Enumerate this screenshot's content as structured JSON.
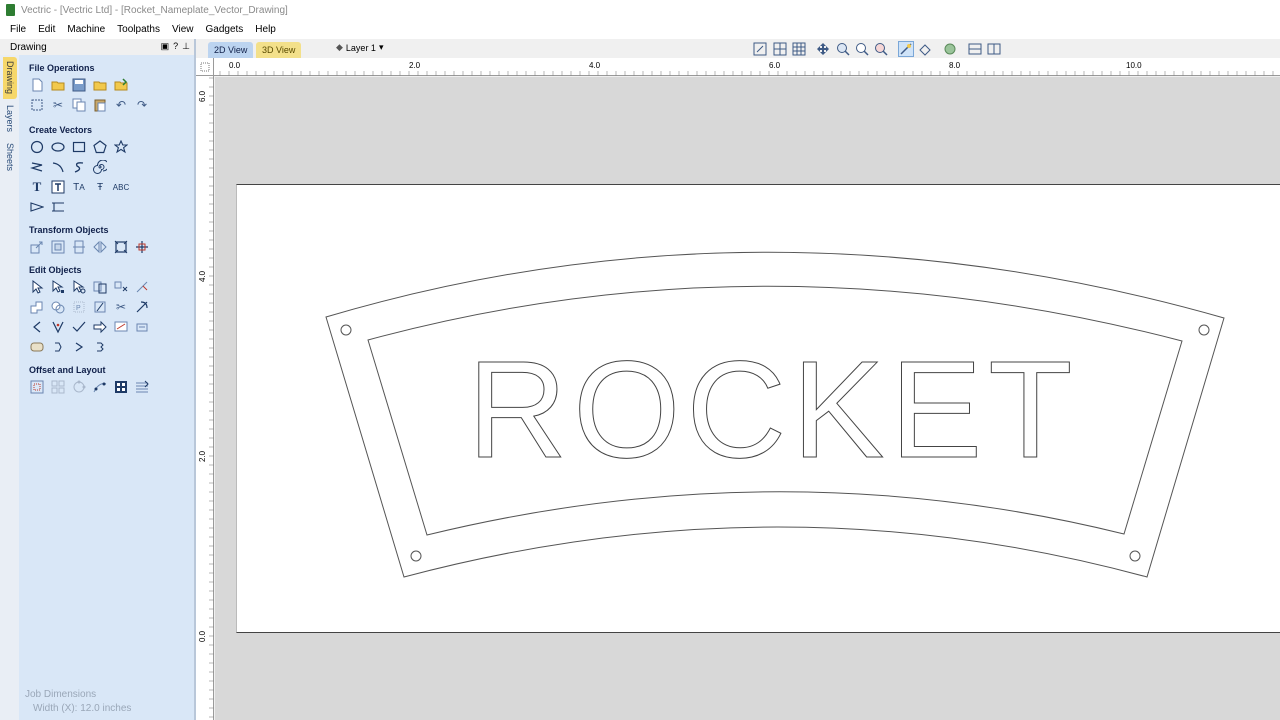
{
  "window": {
    "title": "Vectric - [Vectric Ltd] - [Rocket_Nameplate_Vector_Drawing]"
  },
  "menu": [
    "File",
    "Edit",
    "Machine",
    "Toolpaths",
    "View",
    "Gadgets",
    "Help"
  ],
  "panel": {
    "title": "Drawing",
    "vertical_tabs": [
      "Drawing",
      "Layers",
      "Sheets"
    ],
    "sections": {
      "file_operations": "File Operations",
      "create_vectors": "Create Vectors",
      "transform_objects": "Transform Objects",
      "edit_objects": "Edit Objects",
      "offset_layout": "Offset and Layout"
    },
    "job_dimensions": {
      "title": "Job Dimensions",
      "width": "Width  (X): 12.0 inches"
    }
  },
  "view": {
    "tab_2d": "2D View",
    "tab_3d": "3D View",
    "layer": "Layer 1"
  },
  "rulers": {
    "top_labels": [
      "0.0",
      "2.0",
      "4.0",
      "6.0",
      "8.0",
      "10.0"
    ],
    "left_labels": [
      "6.0",
      "4.0",
      "2.0",
      "0.0"
    ]
  },
  "drawing": {
    "text": "ROCKET"
  },
  "colors": {
    "panel": "#d9e7f7",
    "active_tab": "#f6d76a",
    "canvas": "#d8d8d8",
    "material": "#ffffff"
  }
}
